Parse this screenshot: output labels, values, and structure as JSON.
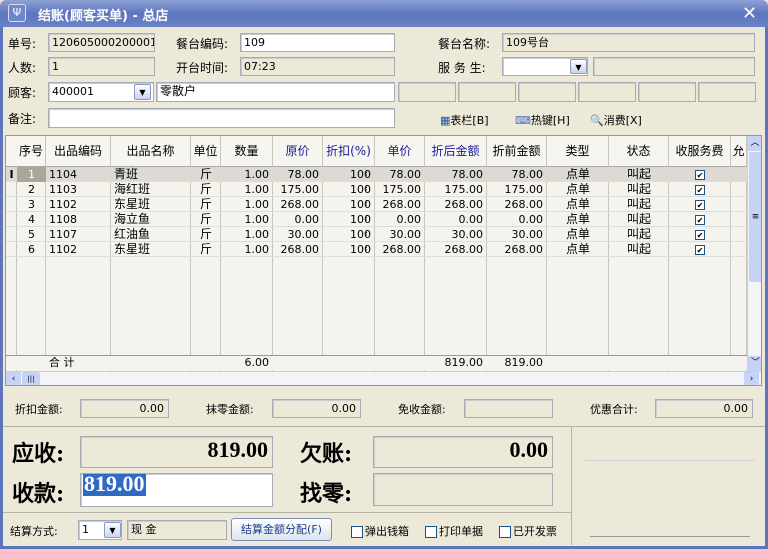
{
  "window": {
    "title": "结账(顾客买单) - 总店"
  },
  "header": {
    "order_no_label": "单号:",
    "order_no": "120605000200001",
    "table_code_label": "餐台编码:",
    "table_code": "109",
    "table_name_label": "餐台名称:",
    "table_name": "109号台",
    "people_label": "人数:",
    "people": "1",
    "open_time_label": "开台时间:",
    "open_time": "07:23",
    "waiter_label": "服 务 生:",
    "waiter": "",
    "customer_label": "顾客:",
    "customer_code": "400001",
    "customer_name": "零散户",
    "remark_label": "备注:",
    "remark": ""
  },
  "toolbar": {
    "columns": "表栏[B]",
    "hotkeys": "热键[H]",
    "consume": "消费[X]"
  },
  "grid": {
    "columns": [
      "序号",
      "出品编码",
      "出品名称",
      "单位",
      "数量",
      "原价",
      "折扣(%)",
      "单价",
      "折后金额",
      "折前金额",
      "类型",
      "状态",
      "收服务费",
      "允"
    ],
    "rows": [
      {
        "no": "1",
        "code": "1104",
        "name": "青班",
        "unit": "斤",
        "qty": "1.00",
        "price": "78.00",
        "disc": "100",
        "unit_price": "78.00",
        "after": "78.00",
        "before": "78.00",
        "type": "点单",
        "status": "叫起",
        "service": true
      },
      {
        "no": "2",
        "code": "1103",
        "name": "海红班",
        "unit": "斤",
        "qty": "1.00",
        "price": "175.00",
        "disc": "100",
        "unit_price": "175.00",
        "after": "175.00",
        "before": "175.00",
        "type": "点单",
        "status": "叫起",
        "service": true
      },
      {
        "no": "3",
        "code": "1102",
        "name": "东星班",
        "unit": "斤",
        "qty": "1.00",
        "price": "268.00",
        "disc": "100",
        "unit_price": "268.00",
        "after": "268.00",
        "before": "268.00",
        "type": "点单",
        "status": "叫起",
        "service": true
      },
      {
        "no": "4",
        "code": "1108",
        "name": "海立鱼",
        "unit": "斤",
        "qty": "1.00",
        "price": "0.00",
        "disc": "100",
        "unit_price": "0.00",
        "after": "0.00",
        "before": "0.00",
        "type": "点单",
        "status": "叫起",
        "service": true
      },
      {
        "no": "5",
        "code": "1107",
        "name": "红油鱼",
        "unit": "斤",
        "qty": "1.00",
        "price": "30.00",
        "disc": "100",
        "unit_price": "30.00",
        "after": "30.00",
        "before": "30.00",
        "type": "点单",
        "status": "叫起",
        "service": true
      },
      {
        "no": "6",
        "code": "1102",
        "name": "东星班",
        "unit": "斤",
        "qty": "1.00",
        "price": "268.00",
        "disc": "100",
        "unit_price": "268.00",
        "after": "268.00",
        "before": "268.00",
        "type": "点单",
        "status": "叫起",
        "service": true
      }
    ],
    "total_label": "合  计",
    "total_qty": "6.00",
    "total_after": "819.00",
    "total_before": "819.00"
  },
  "summary": {
    "discount_label": "折扣金额:",
    "discount": "0.00",
    "rounding_label": "抹零金额:",
    "rounding": "0.00",
    "waived_label": "免收金额:",
    "waived": "",
    "promo_label": "优惠合计:",
    "promo": "0.00"
  },
  "payment": {
    "receivable_label": "应收:",
    "receivable": "819.00",
    "owed_label": "欠账:",
    "owed": "0.00",
    "received_label": "收款:",
    "received": "819.00",
    "change_label": "找零:",
    "change": ""
  },
  "footer": {
    "method_label": "结算方式:",
    "method_code": "1",
    "method_name": "现  金",
    "allocate_button": "结算金额分配(F)",
    "open_drawer": "弹出钱箱",
    "print_receipt": "打印单据",
    "invoiced": "已开发票"
  }
}
